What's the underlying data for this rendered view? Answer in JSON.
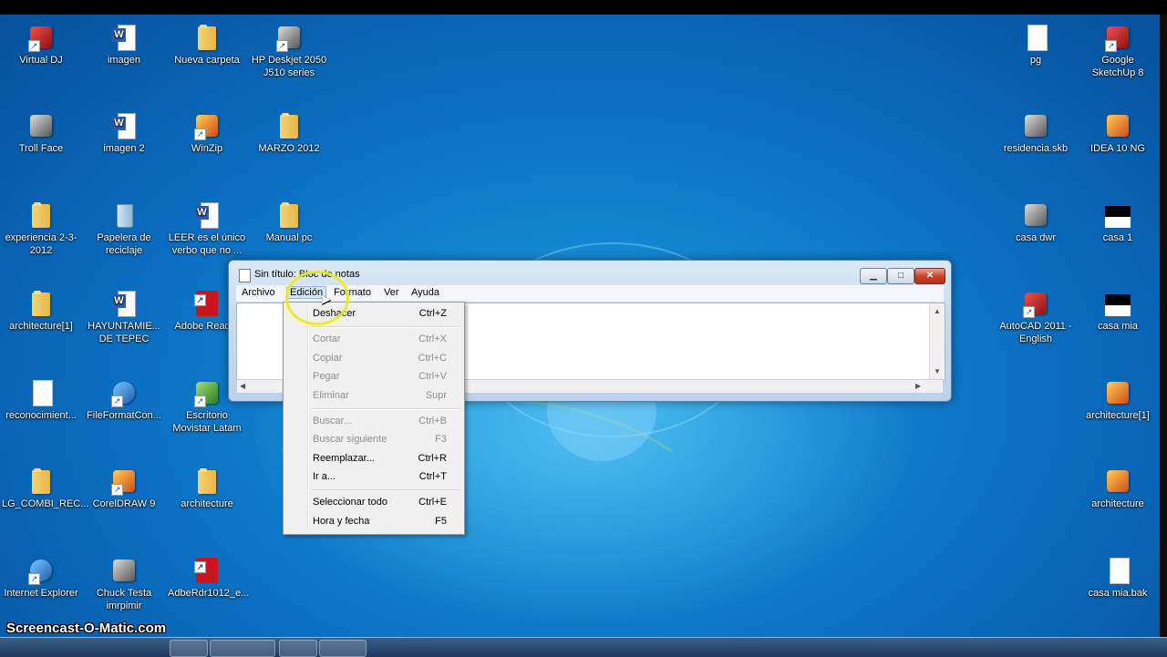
{
  "desktop_icons": [
    {
      "id": "virtual-dj",
      "label": "Virtual DJ",
      "kind": "app red shortcut"
    },
    {
      "id": "imagen",
      "label": "imagen",
      "kind": "word"
    },
    {
      "id": "nueva-carpeta",
      "label": "Nueva carpeta",
      "kind": "folder"
    },
    {
      "id": "hp-deskjet",
      "label": "HP Deskjet 2050 J510 series",
      "kind": "app gray shortcut"
    },
    {
      "id": "troll-face",
      "label": "Troll Face",
      "kind": "app gray"
    },
    {
      "id": "imagen-2",
      "label": "imagen 2",
      "kind": "word"
    },
    {
      "id": "winzip",
      "label": "WinZip",
      "kind": "app orange shortcut"
    },
    {
      "id": "marzo-2012",
      "label": "MARZO 2012",
      "kind": "folder"
    },
    {
      "id": "experiencia",
      "label": "experiencia 2-3-2012",
      "kind": "folder"
    },
    {
      "id": "papelera",
      "label": "Papelera de reciclaje",
      "kind": "trash"
    },
    {
      "id": "leer",
      "label": "LEER es el único verbo que no ...",
      "kind": "word"
    },
    {
      "id": "manual-pc",
      "label": "Manual pc",
      "kind": "folder"
    },
    {
      "id": "architecture1-folder",
      "label": "architecture[1]",
      "kind": "folder"
    },
    {
      "id": "hayuntamie",
      "label": "HAYUNTAMIE... DE TEPEC",
      "kind": "word"
    },
    {
      "id": "adobe-reader",
      "label": "Adobe Reader",
      "kind": "pdf shortcut"
    },
    {
      "id": "reconocimiento",
      "label": "reconocimient...",
      "kind": "doc"
    },
    {
      "id": "fileformat",
      "label": "FileFormatCon...",
      "kind": "app blue shortcut"
    },
    {
      "id": "escritorio-movistar",
      "label": "Escritorio Movistar Latam",
      "kind": "app green shortcut"
    },
    {
      "id": "lg-combi",
      "label": "LG_COMBI_REC...",
      "kind": "folder"
    },
    {
      "id": "coreldraw",
      "label": "CorelDRAW 9",
      "kind": "app orange shortcut"
    },
    {
      "id": "architecture-folder",
      "label": "architecture",
      "kind": "folder"
    },
    {
      "id": "internet-explorer",
      "label": "Internet Explorer",
      "kind": "app blue shortcut"
    },
    {
      "id": "chuck-testa",
      "label": "Chuck Testa imrpimir",
      "kind": "app gray"
    },
    {
      "id": "adberdr",
      "label": "AdbeRdr1012_e...",
      "kind": "pdf shortcut"
    },
    {
      "id": "pg",
      "label": "pg",
      "kind": "doc"
    },
    {
      "id": "google-sketchup",
      "label": "Google SketchUp 8",
      "kind": "app red shortcut"
    },
    {
      "id": "residencia",
      "label": "residencia.skb",
      "kind": "app gray"
    },
    {
      "id": "idea-10",
      "label": "IDEA 10 NG",
      "kind": "app orange"
    },
    {
      "id": "casa-dwr",
      "label": "casa dwr",
      "kind": "app gray"
    },
    {
      "id": "casa-1",
      "label": "casa 1",
      "kind": "bw"
    },
    {
      "id": "autocad",
      "label": "AutoCAD 2011 - English",
      "kind": "app red shortcut"
    },
    {
      "id": "casa-mia",
      "label": "casa mia",
      "kind": "bw"
    },
    {
      "id": "architecture1-right",
      "label": "architecture[1]",
      "kind": "app orange"
    },
    {
      "id": "architecture-right",
      "label": "architecture",
      "kind": "app orange"
    },
    {
      "id": "casa-mia-bak",
      "label": "casa mia.bak",
      "kind": "doc"
    }
  ],
  "notepad": {
    "title": "Sin título: Bloc de notas",
    "min_glyph": "▁",
    "max_glyph": "□",
    "close_glyph": "✕",
    "menu": {
      "archivo": "Archivo",
      "edicion": "Edición",
      "formato": "Formato",
      "ver": "Ver",
      "ayuda": "Ayuda"
    },
    "scroll_up": "▲",
    "scroll_down": "▼",
    "scroll_left": "◀",
    "scroll_right": "▶"
  },
  "edit_menu": {
    "deshacer": {
      "label": "Deshacer",
      "key": "Ctrl+Z",
      "enabled": true
    },
    "cortar": {
      "label": "Cortar",
      "key": "Ctrl+X",
      "enabled": false
    },
    "copiar": {
      "label": "Copiar",
      "key": "Ctrl+C",
      "enabled": false
    },
    "pegar": {
      "label": "Pegar",
      "key": "Ctrl+V",
      "enabled": false
    },
    "eliminar": {
      "label": "Eliminar",
      "key": "Supr",
      "enabled": false
    },
    "buscar": {
      "label": "Buscar...",
      "key": "Ctrl+B",
      "enabled": false
    },
    "buscar_siguiente": {
      "label": "Buscar siguiente",
      "key": "F3",
      "enabled": false
    },
    "reemplazar": {
      "label": "Reemplazar...",
      "key": "Ctrl+R",
      "enabled": true
    },
    "ir_a": {
      "label": "Ir a...",
      "key": "Ctrl+T",
      "enabled": true
    },
    "seleccionar_todo": {
      "label": "Seleccionar todo",
      "key": "Ctrl+E",
      "enabled": true
    },
    "hora_fecha": {
      "label": "Hora y fecha",
      "key": "F5",
      "enabled": true
    }
  },
  "watermark": "Screencast-O-Matic.com"
}
